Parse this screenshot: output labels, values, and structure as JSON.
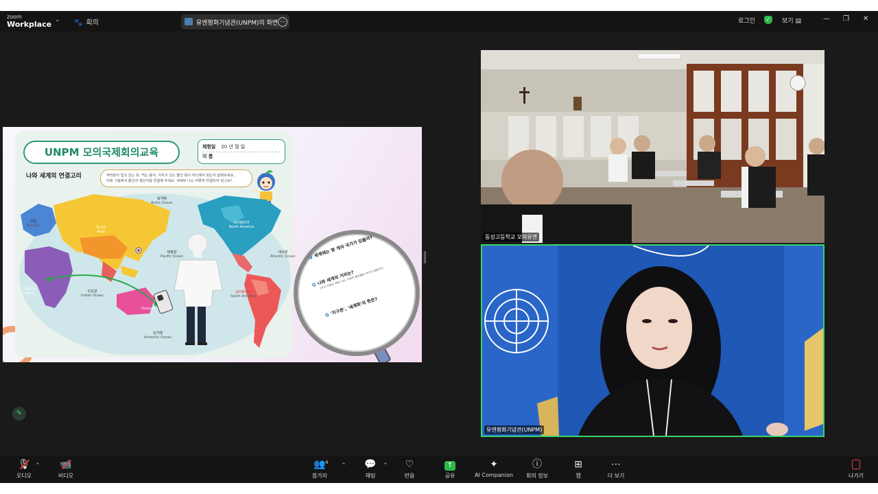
{
  "topbar": {
    "logo_small": "zoom",
    "logo_big": "Workplace",
    "meeting_label": "회의",
    "share_title": "유엔평화기념관(UNPM)의 화면",
    "login": "로그인",
    "view": "보기"
  },
  "slide": {
    "title": "UNPM 모의국제회의교육",
    "date_label": "체험일",
    "date_fields": "20  년    월    일",
    "name_label": "이 름",
    "subtitle": "나와 세계의 연결고리",
    "instruction_line1": "여러분이 입고 있는 옷, 먹는 음식, 가지고 있는 물건 등이 어디에서 왔는지 살펴보세요.",
    "instruction_line2": "아래 그림에서 물건과 생산지를 연결해 주세요. 세계와 나는 어떻게 연결되어 있나요?",
    "map_labels": {
      "europe_ko": "유럽",
      "europe_en": "Europe",
      "asia_ko": "아시아",
      "asia_en": "Asia",
      "africa_ko": "아프리카",
      "africa_en": "Africa",
      "arctic_ko": "북극해",
      "arctic_en": "Arctic Ocean",
      "pacific_ko": "태평양",
      "pacific_en": "Pacific Ocean",
      "indian_ko": "인도양",
      "indian_en": "Indian Ocean",
      "atlantic_ko": "대서양",
      "atlantic_en": "Atlantic Ocean",
      "north_america_ko": "북아메리카",
      "north_america_en": "North America",
      "south_america_ko": "남아메리카",
      "south_america_en": "South America",
      "oceania_en": "Oceania",
      "antarctic_ko": "남극해",
      "antarctic_en": "Antarctic Ocean"
    },
    "questions": {
      "q1": "세계에는 몇 개의 국가가 있을까?",
      "q2": "나와 세계의 거리는?",
      "q2_sub": "(우리 주변의 예와 나라, 주변의 물건들은 어디서 왔을까?)",
      "q3": "'지구촌', '세계화'의 뜻은?"
    }
  },
  "videos": {
    "tile1_name": "동성고등학교 모의유엔",
    "tile2_name": "유엔평화기념관(UNPM)"
  },
  "toolbar": {
    "audio": "오디오",
    "video": "비디오",
    "participants": "참가자",
    "participants_count": "4",
    "chat": "채팅",
    "react": "반응",
    "share": "공유",
    "ai": "AI Companion",
    "info": "회의 정보",
    "apps": "앱",
    "more": "더 보기",
    "leave": "나가기"
  },
  "colors": {
    "bg": "#1a1a1a",
    "active_speaker": "#3ad36b",
    "share_green": "#2fb84a",
    "muted_red": "#e03c3c",
    "un_blue": "#1f58b5"
  }
}
